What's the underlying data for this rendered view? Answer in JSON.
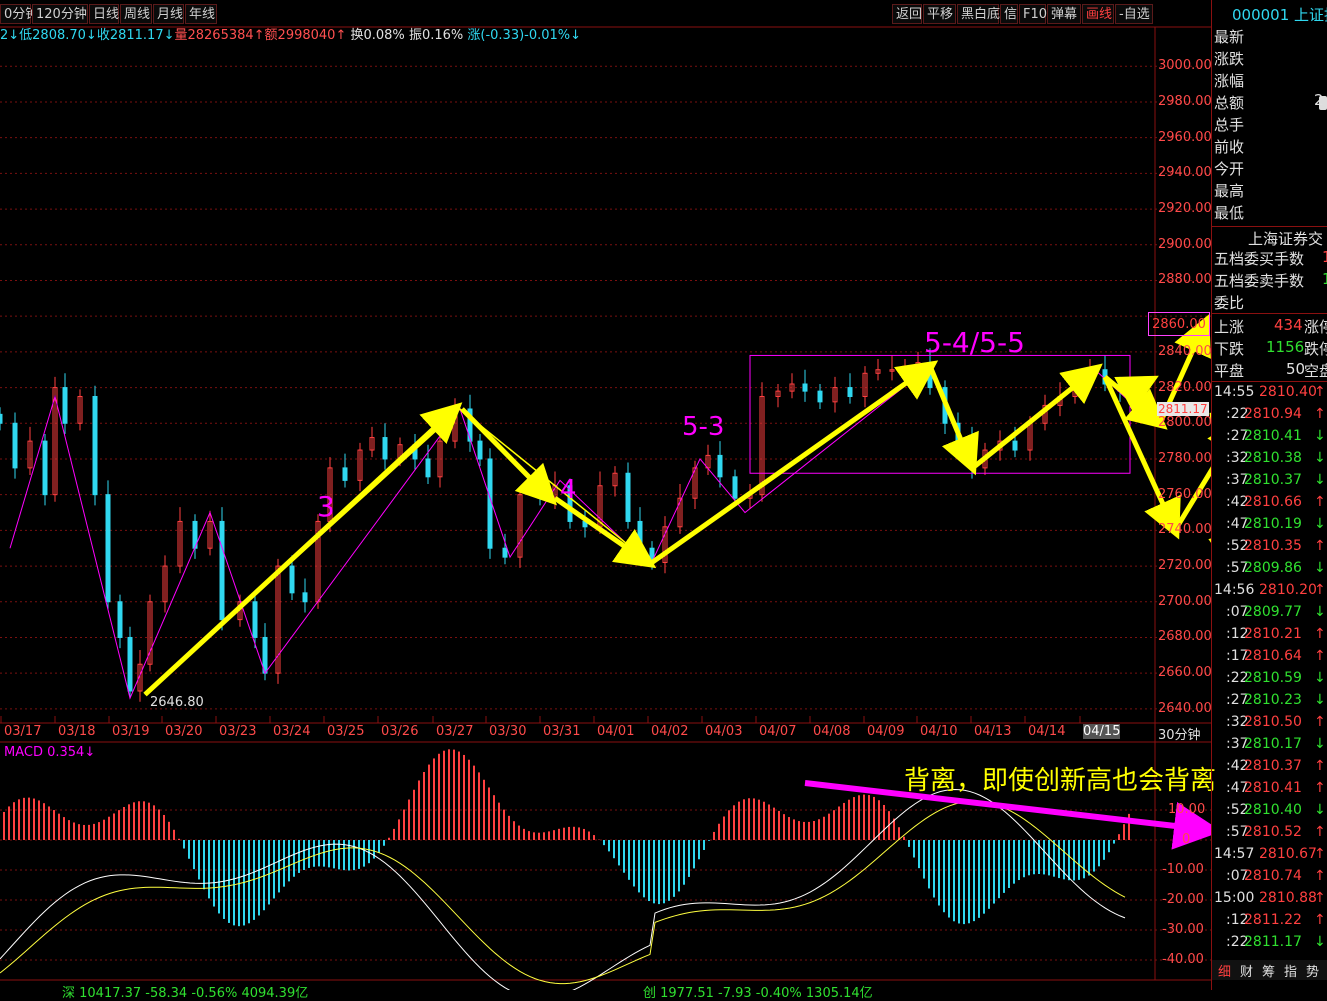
{
  "toolbar": {
    "left_buttons": [
      "0分钟",
      "120分钟",
      "日线",
      "周线",
      "月线",
      "年线"
    ],
    "right_buttons": [
      "返回",
      "平移",
      "黑白底",
      "信",
      "F10",
      "弹幕",
      "画线",
      "-自选"
    ],
    "active_button": "画线",
    "code": "000001 上证指"
  },
  "info": {
    "low": "2↓低2808.70↓",
    "close": "收2811.17↓",
    "volume": "量28265384↑",
    "amount": "额2998040↑",
    "turnover": "换0.08%",
    "amplitude": "振0.16%",
    "change": "涨(-0.33)-0.01%↓"
  },
  "quote": {
    "labels": [
      "最新",
      "涨跌",
      "涨幅",
      "总额",
      "总手",
      "前收",
      "今开",
      "最高",
      "最低"
    ],
    "amount_partial": "2",
    "exchange": "上海证券交",
    "wudang_buy": "五档委买手数",
    "wudang_sell": "五档委卖手数",
    "weibi": "委比",
    "buy_val": "1",
    "sell_val": "1",
    "up_label": "上涨",
    "up_count": "434",
    "up_tail": "涨停",
    "down_label": "下跌",
    "down_count": "1156",
    "down_tail": "跌停",
    "flat_label": "平盘",
    "flat_count": "50",
    "flat_tail": "空盘"
  },
  "ticks": [
    {
      "time": "14:55",
      "price": "2810.40",
      "dir": "↑",
      "color": "#ff4040",
      "tcolor": "#e0e0e0"
    },
    {
      "time": ":22",
      "price": "2810.94",
      "dir": "↑",
      "color": "#ff4040",
      "tcolor": "#e0e0e0"
    },
    {
      "time": ":27",
      "price": "2810.41",
      "dir": "↓",
      "color": "#30e030",
      "tcolor": "#e0e0e0"
    },
    {
      "time": ":32",
      "price": "2810.38",
      "dir": "↓",
      "color": "#30e030",
      "tcolor": "#e0e0e0"
    },
    {
      "time": ":37",
      "price": "2810.37",
      "dir": "↓",
      "color": "#30e030",
      "tcolor": "#e0e0e0"
    },
    {
      "time": ":42",
      "price": "2810.66",
      "dir": "↑",
      "color": "#ff4040",
      "tcolor": "#e0e0e0"
    },
    {
      "time": ":47",
      "price": "2810.19",
      "dir": "↓",
      "color": "#30e030",
      "tcolor": "#e0e0e0"
    },
    {
      "time": ":52",
      "price": "2810.35",
      "dir": "↑",
      "color": "#ff4040",
      "tcolor": "#e0e0e0"
    },
    {
      "time": ":57",
      "price": "2809.86",
      "dir": "↓",
      "color": "#30e030",
      "tcolor": "#e0e0e0"
    },
    {
      "time": "14:56",
      "price": "2810.20",
      "dir": "↑",
      "color": "#ff4040",
      "tcolor": "#e0e0e0"
    },
    {
      "time": ":07",
      "price": "2809.77",
      "dir": "↓",
      "color": "#30e030",
      "tcolor": "#e0e0e0"
    },
    {
      "time": ":12",
      "price": "2810.21",
      "dir": "↑",
      "color": "#ff4040",
      "tcolor": "#e0e0e0"
    },
    {
      "time": ":17",
      "price": "2810.64",
      "dir": "↑",
      "color": "#ff4040",
      "tcolor": "#e0e0e0"
    },
    {
      "time": ":22",
      "price": "2810.59",
      "dir": "↓",
      "color": "#30e030",
      "tcolor": "#e0e0e0"
    },
    {
      "time": ":27",
      "price": "2810.23",
      "dir": "↓",
      "color": "#30e030",
      "tcolor": "#e0e0e0"
    },
    {
      "time": ":32",
      "price": "2810.50",
      "dir": "↑",
      "color": "#ff4040",
      "tcolor": "#e0e0e0"
    },
    {
      "time": ":37",
      "price": "2810.17",
      "dir": "↓",
      "color": "#30e030",
      "tcolor": "#e0e0e0"
    },
    {
      "time": ":42",
      "price": "2810.37",
      "dir": "↑",
      "color": "#ff4040",
      "tcolor": "#e0e0e0"
    },
    {
      "time": ":47",
      "price": "2810.41",
      "dir": "↑",
      "color": "#ff4040",
      "tcolor": "#e0e0e0"
    },
    {
      "time": ":52",
      "price": "2810.40",
      "dir": "↓",
      "color": "#30e030",
      "tcolor": "#e0e0e0"
    },
    {
      "time": ":57",
      "price": "2810.52",
      "dir": "↑",
      "color": "#ff4040",
      "tcolor": "#e0e0e0"
    },
    {
      "time": "14:57",
      "price": "2810.67",
      "dir": "↑",
      "color": "#ff4040",
      "tcolor": "#e0e0e0"
    },
    {
      "time": ":07",
      "price": "2810.74",
      "dir": "↑",
      "color": "#ff4040",
      "tcolor": "#e0e0e0"
    },
    {
      "time": "15:00",
      "price": "2810.88",
      "dir": "↑",
      "color": "#ff4040",
      "tcolor": "#e0e0e0"
    },
    {
      "time": ":12",
      "price": "2811.22",
      "dir": "↑",
      "color": "#ff4040",
      "tcolor": "#e0e0e0"
    },
    {
      "time": ":22",
      "price": "2811.17",
      "dir": "↓",
      "color": "#30e030",
      "tcolor": "#e0e0e0"
    }
  ],
  "tick_extra": {
    "row_24_tail": "24",
    "row_26_tail": "3"
  },
  "bottom_tabs": [
    "细",
    "财",
    "筹",
    "指",
    "势"
  ],
  "price_axis": [
    "3000.00",
    "2980.00",
    "2960.00",
    "2940.00",
    "2920.00",
    "2900.00",
    "2880.00",
    "2860.00",
    "2840.00",
    "2820.00",
    "2800.00",
    "2780.00",
    "2760.00",
    "2740.00",
    "2720.00",
    "2700.00",
    "2680.00",
    "2660.00",
    "2640.00"
  ],
  "highlight_price": "2860.00",
  "last_price": "2811.17",
  "macd_axis": [
    "10.00",
    "0",
    "-10.00",
    "-20.00",
    "-30.00",
    "-40.00"
  ],
  "dates": [
    "03/17",
    "03/18",
    "03/19",
    "03/20",
    "03/23",
    "03/24",
    "03/25",
    "03/26",
    "03/27",
    "03/30",
    "03/31",
    "04/01",
    "04/02",
    "04/03",
    "04/07",
    "04/08",
    "04/09",
    "04/10",
    "04/13",
    "04/14",
    "04/15"
  ],
  "period_label": "30分钟",
  "macd_label": "MACD 0.354↓",
  "low_label": "2646.80",
  "annotations": {
    "wave3": "3",
    "wave4": "4",
    "wave53": "5-3",
    "wave545": "5-4/5-5",
    "divergence": "背离，即使创新高也会背离"
  },
  "footer": {
    "left_text": "深 10417.37 -58.34 -0.56% 4094.39亿",
    "right_text": "创 1977.51 -7.93 -0.40% 1305.14亿"
  },
  "colors": {
    "up": "#ff4040",
    "down": "#30d8f0",
    "yellow": "#ffff00",
    "magenta": "#ff00ff",
    "grid": "#7a1010"
  }
}
